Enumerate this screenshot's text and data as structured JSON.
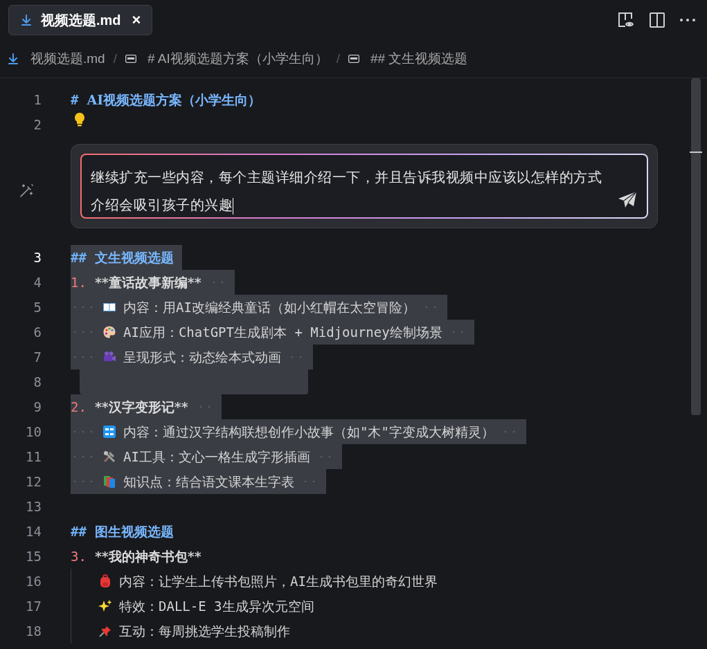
{
  "tab": {
    "title": "视频选题.md",
    "selected": true,
    "close": "×"
  },
  "breadcrumbs": [
    {
      "label": "视频选题.md",
      "kind": "file"
    },
    {
      "separator": "/",
      "label": "# AI视频选题方案（小学生向）",
      "kind": "symbol"
    },
    {
      "separator": "/",
      "label": "## 文生视频选题",
      "kind": "symbol"
    }
  ],
  "editor": {
    "lines": [
      {
        "number": "1",
        "kind": "heading",
        "marker": "#",
        "text": "AI视频选题方案（小学生向）",
        "selected": false,
        "current": false
      },
      {
        "number": "2",
        "kind": "bulb",
        "selected": false,
        "current": false
      },
      {
        "kind": "prompt",
        "text": "继续扩充一些内容，每个主题详细介绍一下，并且告诉我视频中应该以怎样的方式介绍会吸引孩子的兴趣"
      },
      {
        "number": "3",
        "kind": "heading",
        "marker": "##",
        "text": "文生视频选题",
        "selected": true,
        "current": true
      },
      {
        "number": "4",
        "kind": "list",
        "marker": "1.",
        "text": "**童话故事新编**",
        "selected": true,
        "current": false
      },
      {
        "number": "5",
        "kind": "item",
        "text": "内容：用AI改编经典童话（如小红帽在太空冒险）",
        "selected": true,
        "current": false
      },
      {
        "number": "6",
        "kind": "item",
        "text": "AI应用：ChatGPT生成剧本 + Midjourney绘制场景",
        "selected": true,
        "current": false
      },
      {
        "number": "7",
        "kind": "item",
        "text": "呈现形式：动态绘本式动画",
        "selected": true,
        "current": false
      },
      {
        "number": "8",
        "kind": "blank",
        "selected": true,
        "current": false
      },
      {
        "number": "9",
        "kind": "list",
        "marker": "2.",
        "text": "**汉字变形记**",
        "selected": true,
        "current": false
      },
      {
        "number": "10",
        "kind": "item",
        "text": "内容：通过汉字结构联想创作小故事（如\"木\"字变成大树精灵）",
        "selected": true,
        "current": false
      },
      {
        "number": "11",
        "kind": "item",
        "text": "AI工具：文心一格生成字形插画",
        "selected": true,
        "current": false
      },
      {
        "number": "12",
        "kind": "item",
        "text": "知识点：结合语文课本生字表",
        "selected": true,
        "current": false
      },
      {
        "number": "13",
        "kind": "blank",
        "selected": false,
        "current": false
      },
      {
        "number": "14",
        "kind": "heading",
        "marker": "##",
        "text": "图生视频选题",
        "selected": false,
        "current": false
      },
      {
        "number": "15",
        "kind": "list",
        "marker": "3.",
        "text": "**我的神奇书包**",
        "selected": false,
        "current": false
      },
      {
        "number": "16",
        "kind": "item",
        "text": "内容：让学生上传书包照片，AI生成书包里的奇幻世界",
        "selected": false,
        "current": false
      },
      {
        "number": "17",
        "kind": "item",
        "text": "特效：DALL-E 3生成异次元空间",
        "selected": false,
        "current": false
      },
      {
        "number": "18",
        "kind": "item",
        "text": "互动：每周挑选学生投稿制作",
        "selected": false,
        "current": false
      }
    ]
  }
}
